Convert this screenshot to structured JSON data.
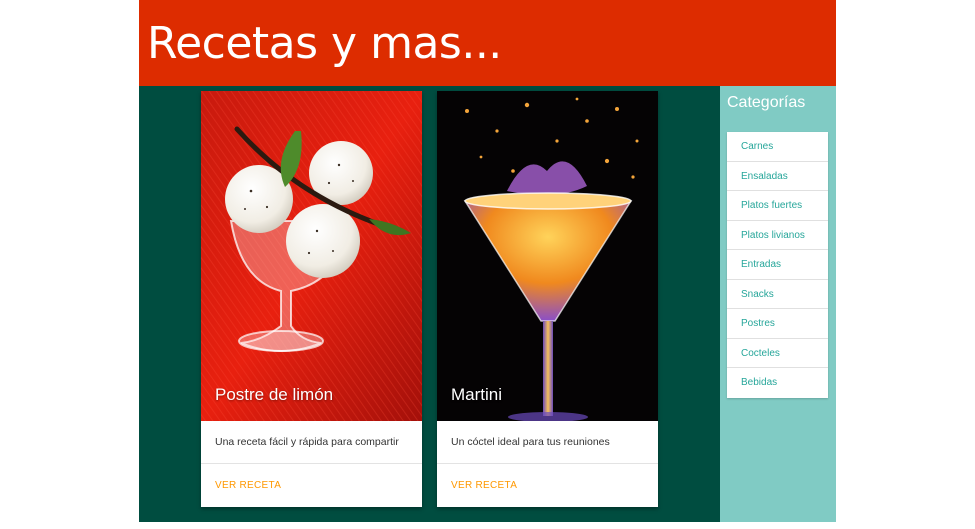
{
  "header": {
    "title": "Recetas y mas..."
  },
  "cards": [
    {
      "title": "Postre de limón",
      "description": "Una receta fácil y rápida para compartir",
      "action": "VER RECETA",
      "image_icon": "ice-cream-dessert-image"
    },
    {
      "title": "Martini",
      "description": "Un cóctel ideal para tus reuniones",
      "action": "VER RECETA",
      "image_icon": "martini-cocktail-image"
    }
  ],
  "sidebar": {
    "title": "Categorías",
    "items": [
      {
        "label": "Carnes"
      },
      {
        "label": "Ensaladas"
      },
      {
        "label": "Platos fuertes"
      },
      {
        "label": "Platos livianos"
      },
      {
        "label": "Entradas"
      },
      {
        "label": "Snacks"
      },
      {
        "label": "Postres"
      },
      {
        "label": "Cocteles"
      },
      {
        "label": "Bebidas"
      }
    ]
  },
  "colors": {
    "header": "#dd2c00",
    "main": "#004d40",
    "sidebar": "#80cbc4",
    "link": "#26a69a",
    "action": "#ff9800"
  }
}
